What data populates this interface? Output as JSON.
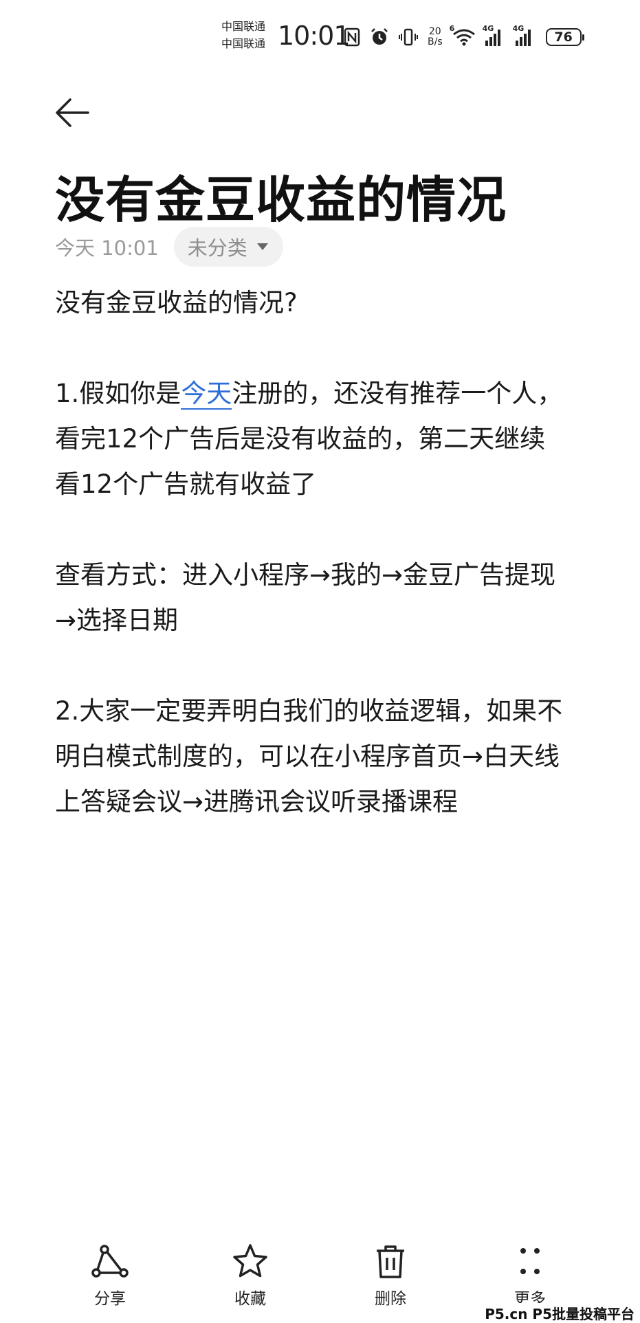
{
  "status_bar": {
    "carrier_1": "中国联通",
    "carrier_2": "中国联通",
    "time": "10:01",
    "net_speed_value": "20",
    "net_speed_unit": "B/s",
    "wifi_tag": "6",
    "sim1_tag": "4G",
    "sim2_tag": "4G",
    "battery": "76",
    "icons": [
      "nfc-icon",
      "alarm-icon",
      "vibrate-icon",
      "wifi-icon",
      "signal-icon",
      "signal-icon",
      "battery-icon"
    ]
  },
  "header": {
    "back_icon": "arrow-left-icon",
    "title": "没有金豆收益的情况",
    "date": "今天 10:01",
    "category": "未分类",
    "category_icon": "caret-down-icon"
  },
  "body": {
    "line_1": "没有金豆收益的情况?",
    "para_1_prefix": "1.假如你是",
    "para_1_link": "今天",
    "para_1_line_1_rest": "注册的，还没有推荐一个人，",
    "para_1_line_2": "看完12个广告后是没有收益的，第二天继续",
    "para_1_line_3": "看12个广告就有收益了",
    "para_2_line_1": "查看方式：进入小程序→我的→金豆广告提现",
    "para_2_line_2": "→选择日期",
    "para_3_line_1": "2.大家一定要弄明白我们的收益逻辑，如果不",
    "para_3_line_2": "明白模式制度的，可以在小程序首页→白天线",
    "para_3_line_3": "上答疑会议→进腾讯会议听录播课程"
  },
  "toolbar": {
    "items": [
      {
        "label": "分享",
        "icon": "share-icon"
      },
      {
        "label": "收藏",
        "icon": "star-icon"
      },
      {
        "label": "删除",
        "icon": "trash-icon"
      },
      {
        "label": "更多",
        "icon": "more-icon"
      }
    ]
  },
  "watermark": "P5.cn P5批量投稿平台",
  "colors": {
    "link": "#2f6ed6",
    "text": "#1a1a1a",
    "muted": "#9a9a9a",
    "chip_bg": "#f1f1f1"
  }
}
